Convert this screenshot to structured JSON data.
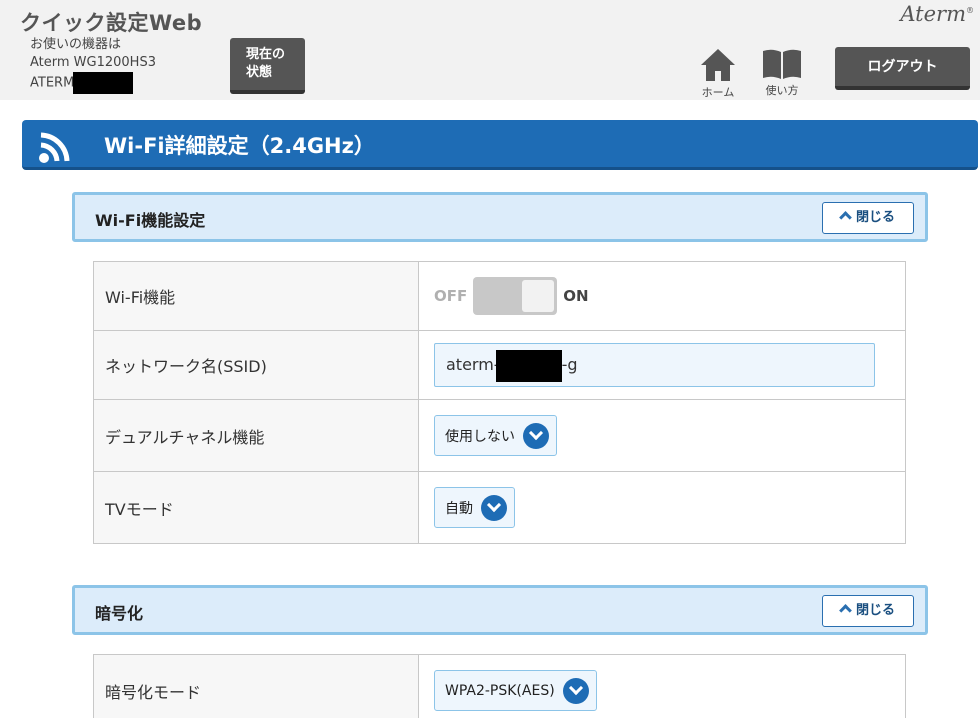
{
  "header": {
    "app_title": "クイック設定Web",
    "device_label": "お使いの機器は",
    "device_model": "Aterm WG1200HS3",
    "device_id_prefix": "ATERM-",
    "status_button": "現在の\n状態",
    "brand": "Aterm",
    "brand_mark": "®",
    "nav": {
      "home_label": "ホーム",
      "manual_label": "使い方"
    },
    "logout_label": "ログアウト"
  },
  "page": {
    "title": "Wi-Fi詳細設定（2.4GHz）"
  },
  "sections": {
    "wifi_function": {
      "title": "Wi-Fi機能設定",
      "close_label": "閉じる",
      "rows": {
        "wifi": {
          "label": "Wi-Fi機能",
          "off_label": "OFF",
          "on_label": "ON"
        },
        "ssid": {
          "label": "ネットワーク名(SSID)",
          "value_prefix": "aterm-",
          "value_suffix": "-g"
        },
        "dual_channel": {
          "label": "デュアルチャネル機能",
          "value": "使用しない"
        },
        "tv_mode": {
          "label": "TVモード",
          "value": "自動"
        }
      }
    },
    "encryption": {
      "title": "暗号化",
      "close_label": "閉じる",
      "rows": {
        "mode": {
          "label": "暗号化モード",
          "value": "WPA2-PSK(AES)"
        }
      }
    }
  }
}
